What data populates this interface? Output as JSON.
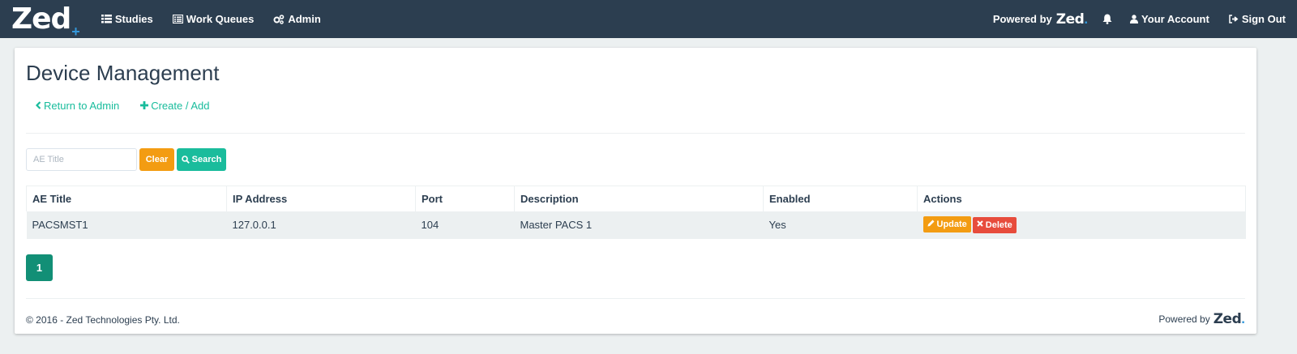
{
  "navbar": {
    "brand": "Zed",
    "brand_mark": "+",
    "items": [
      {
        "label": "Studies",
        "icon": "list-icon"
      },
      {
        "label": "Work Queues",
        "icon": "list-alt-icon"
      },
      {
        "label": "Admin",
        "icon": "gears-icon"
      }
    ],
    "powered_by_label": "Powered by",
    "powered_by_brand": "Zed",
    "powered_by_mark": ".",
    "account_label": "Your Account",
    "signout_label": "Sign Out"
  },
  "page": {
    "title": "Device Management",
    "links": {
      "return_label": "Return to Admin",
      "create_label": "Create / Add"
    }
  },
  "search": {
    "placeholder": "AE Title",
    "value": "",
    "clear_label": "Clear",
    "search_label": "Search"
  },
  "table": {
    "headers": [
      "AE Title",
      "IP Address",
      "Port",
      "Description",
      "Enabled",
      "Actions"
    ],
    "rows": [
      {
        "ae_title": "PACSMST1",
        "ip": "127.0.0.1",
        "port": "104",
        "description": "Master PACS 1",
        "enabled": "Yes",
        "update_label": "Update",
        "delete_label": "Delete"
      }
    ]
  },
  "pagination": {
    "current_page": "1"
  },
  "footer": {
    "copyright": "© 2016 - Zed Technologies Pty. Ltd.",
    "powered_by_label": "Powered by",
    "powered_by_brand": "Zed",
    "powered_by_mark": "."
  },
  "colors": {
    "navbar": "#2c3e50",
    "accent": "#18bc9c",
    "warning": "#f39c12",
    "danger": "#e74c3c",
    "brand_mark": "#3498db",
    "pager_active": "#128f76"
  }
}
